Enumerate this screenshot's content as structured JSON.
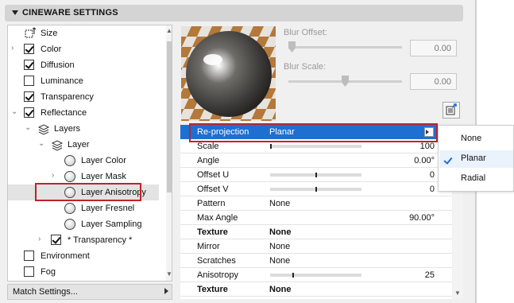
{
  "header": {
    "title": "CINEWARE SETTINGS"
  },
  "tree": {
    "items": [
      {
        "label": "Size",
        "indent": 0,
        "kind": "icon",
        "checked": null,
        "expandable": false,
        "selected": false
      },
      {
        "label": "Color",
        "indent": 0,
        "kind": "checkbox",
        "checked": true,
        "expandable": true,
        "selected": false
      },
      {
        "label": "Diffusion",
        "indent": 0,
        "kind": "checkbox",
        "checked": true,
        "expandable": false,
        "selected": false
      },
      {
        "label": "Luminance",
        "indent": 0,
        "kind": "checkbox",
        "checked": false,
        "expandable": false,
        "selected": false
      },
      {
        "label": "Transparency",
        "indent": 0,
        "kind": "checkbox",
        "checked": true,
        "expandable": false,
        "selected": false
      },
      {
        "label": "Reflectance",
        "indent": 0,
        "kind": "checkbox",
        "checked": true,
        "expandable": true,
        "selected": false
      },
      {
        "label": "Layers",
        "indent": 1,
        "kind": "layers",
        "checked": null,
        "expandable": true,
        "selected": false
      },
      {
        "label": "Layer",
        "indent": 2,
        "kind": "layers",
        "checked": null,
        "expandable": true,
        "selected": false
      },
      {
        "label": "Layer Color",
        "indent": 3,
        "kind": "sphere",
        "checked": null,
        "expandable": false,
        "selected": false
      },
      {
        "label": "Layer Mask",
        "indent": 3,
        "kind": "sphere",
        "checked": null,
        "expandable": true,
        "selected": false
      },
      {
        "label": "Layer Anisotropy",
        "indent": 3,
        "kind": "sphere",
        "checked": null,
        "expandable": false,
        "selected": true
      },
      {
        "label": "Layer Fresnel",
        "indent": 3,
        "kind": "sphere",
        "checked": null,
        "expandable": false,
        "selected": false
      },
      {
        "label": "Layer Sampling",
        "indent": 3,
        "kind": "sphere",
        "checked": null,
        "expandable": false,
        "selected": false
      },
      {
        "label": "* Transparency *",
        "indent": 2,
        "kind": "checkbox",
        "checked": true,
        "expandable": true,
        "selected": false
      },
      {
        "label": "Environment",
        "indent": 0,
        "kind": "checkbox",
        "checked": false,
        "expandable": false,
        "selected": false
      },
      {
        "label": "Fog",
        "indent": 0,
        "kind": "checkbox",
        "checked": false,
        "expandable": false,
        "selected": false
      }
    ]
  },
  "match_settings": {
    "label": "Match Settings..."
  },
  "blur_offset": {
    "label": "Blur Offset:",
    "value": "0.00",
    "slider_fraction": 0.0
  },
  "blur_scale": {
    "label": "Blur Scale:",
    "value": "0.00",
    "slider_fraction": 0.5
  },
  "properties": [
    {
      "name": "Re-projection",
      "value": "Planar",
      "number": "",
      "bar": null,
      "bold": false,
      "highlighted": true
    },
    {
      "name": "Scale",
      "value": "",
      "number": "100",
      "bar": 0.0,
      "bold": false,
      "highlighted": false
    },
    {
      "name": "Angle",
      "value": "",
      "number": "0.00°",
      "bar": null,
      "bold": false,
      "highlighted": false
    },
    {
      "name": "Offset U",
      "value": "",
      "number": "0",
      "bar": 0.5,
      "bold": false,
      "highlighted": false
    },
    {
      "name": "Offset V",
      "value": "",
      "number": "0",
      "bar": 0.5,
      "bold": false,
      "highlighted": false
    },
    {
      "name": "Pattern",
      "value": "None",
      "number": "",
      "bar": null,
      "bold": false,
      "highlighted": false
    },
    {
      "name": "Max Angle",
      "value": "",
      "number": "90.00°",
      "bar": null,
      "bold": false,
      "highlighted": false
    },
    {
      "name": "Texture",
      "value": "None",
      "number": "",
      "bar": null,
      "bold": true,
      "highlighted": false
    },
    {
      "name": "Mirror",
      "value": "None",
      "number": "",
      "bar": null,
      "bold": false,
      "highlighted": false
    },
    {
      "name": "Scratches",
      "value": "None",
      "number": "",
      "bar": null,
      "bold": false,
      "highlighted": false
    },
    {
      "name": "Anisotropy",
      "value": "",
      "number": "25",
      "bar": 0.25,
      "bold": false,
      "highlighted": false
    },
    {
      "name": "Texture",
      "value": "None",
      "number": "",
      "bar": null,
      "bold": true,
      "highlighted": false
    }
  ],
  "dropdown_menu": {
    "options": [
      "None",
      "Planar",
      "Radial"
    ],
    "selected": "Planar"
  },
  "colors": {
    "highlight": "#1e6fd2",
    "annotation": "#c0222a"
  }
}
